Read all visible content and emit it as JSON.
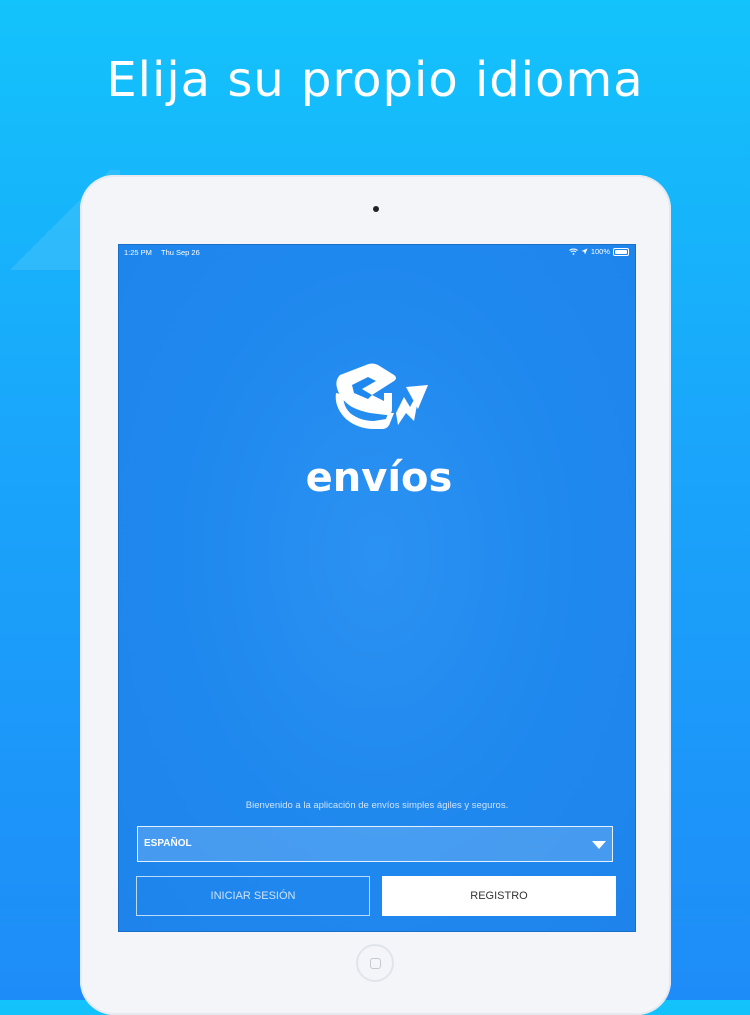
{
  "headline": "Elija su propio idioma",
  "status_bar": {
    "time": "1:25 PM",
    "date": "Thu Sep 26",
    "battery": "100%"
  },
  "app": {
    "logo_text": "envíos",
    "welcome_text": "Bienvenido a la aplicación de envíos simples ágiles y seguros.",
    "language_select": {
      "selected": "ESPAÑOL"
    },
    "login_button": "INICIAR SESIÓN",
    "register_button": "REGISTRO"
  },
  "colors": {
    "background_top": "#13c3fb",
    "background_bottom": "#1e8cf8",
    "screen_blue": "#1f88ee",
    "white": "#ffffff"
  }
}
